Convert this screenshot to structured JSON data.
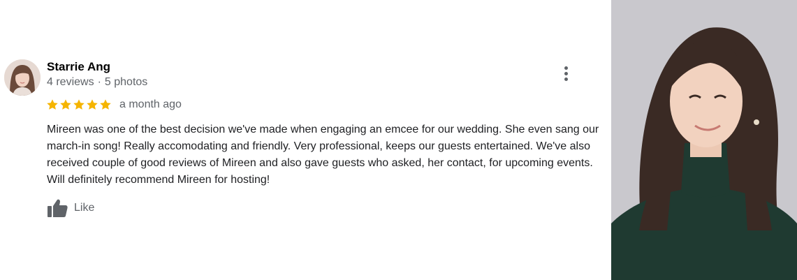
{
  "review": {
    "author": {
      "name": "Starrie Ang",
      "reviews_count": "4 reviews",
      "photos_count": "5 photos"
    },
    "rating": 5,
    "rating_max": 5,
    "time_ago": "a month ago",
    "text": "Mireen was one of the best decision we've made when engaging an emcee for our wedding. She even sang our march-in song! Really accomodating and friendly. Very professional, keeps our guests entertained. We've also received couple of good reviews of Mireen and also gave guests who asked, her contact, for upcoming events. Will definitely recommend Mireen for hosting!",
    "like_label": "Like"
  },
  "icons": {
    "star": "star-icon",
    "more": "more-vert-icon",
    "like": "thumb-up-icon"
  },
  "colors": {
    "star": "#f5b400",
    "secondary_text": "#5f6368",
    "primary_text": "#202124",
    "portrait_background": "#c9c8cd"
  }
}
